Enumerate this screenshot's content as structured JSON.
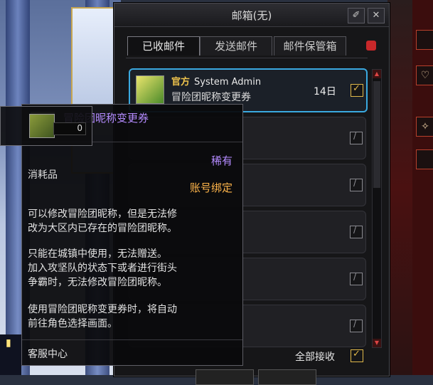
{
  "mailbox": {
    "title": "邮箱(无)",
    "tabs": [
      {
        "label": "已收邮件",
        "active": true
      },
      {
        "label": "发送邮件",
        "active": false
      },
      {
        "label": "邮件保管箱",
        "active": false
      }
    ],
    "mails": [
      {
        "sender_tag": "官方",
        "sender": "System Admin",
        "subject": "冒险团昵称变更券",
        "days": "14日",
        "checked": true,
        "selected": true
      },
      {
        "checked": false
      },
      {
        "checked": false
      },
      {
        "checked": false
      },
      {
        "checked": false
      },
      {
        "checked": false
      }
    ],
    "receive_all_label": "全部接收",
    "receive_all_checked": true
  },
  "tooltip": {
    "item_name": "冒险团昵称变更券",
    "rarity": "稀有",
    "type": "消耗品",
    "binding": "账号绑定",
    "description1": "可以修改冒险团昵称，但是无法修\n改为大区内已存在的冒险团昵称。",
    "description2": "只能在城镇中使用，无法赠送。\n加入攻坚队的状态下或者进行街头\n争霸时，无法修改冒险团昵称。",
    "description3": "使用冒险团昵称变更券时，将自动\n前往角色选择画面。",
    "footer": "客服中心"
  },
  "slot": {
    "quantity": "0"
  },
  "colors": {
    "rarity": "#b48bff",
    "binding": "#ffb54a",
    "official_tag": "#f0c44c",
    "selection_border": "#3aa9e0"
  }
}
